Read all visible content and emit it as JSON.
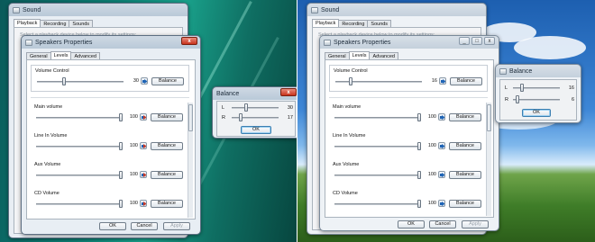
{
  "colors": {
    "vista_bg": "#0d7f74",
    "xp_sky": "#3d86d6",
    "xp_grass": "#3f7d28",
    "close_red": "#c8321c",
    "speaker_blue": "#1f64b5"
  },
  "close_glyph": "x",
  "min_glyph": "_",
  "max_glyph": "□",
  "left": {
    "sound": {
      "title": "Sound",
      "tabs": [
        "Playback",
        "Recording",
        "Sounds"
      ],
      "desc": "Select a playback device below to modify its settings:"
    },
    "props": {
      "title": "Speakers Properties",
      "tabs": [
        "General",
        "Levels",
        "Advanced"
      ],
      "volume_control": {
        "label": "Volume Control",
        "value": "30",
        "level": 0.3,
        "balance": "Balance"
      },
      "channels": [
        {
          "label": "Main volume",
          "value": "100",
          "level": 1.0,
          "balance": "Balance",
          "muted": true
        },
        {
          "label": "Line In Volume",
          "value": "100",
          "level": 1.0,
          "balance": "Balance",
          "muted": true
        },
        {
          "label": "Aux Volume",
          "value": "100",
          "level": 1.0,
          "balance": "Balance",
          "muted": true
        },
        {
          "label": "CD Volume",
          "value": "100",
          "level": 1.0,
          "balance": "Balance",
          "muted": true
        }
      ],
      "ok": "OK",
      "cancel": "Cancel",
      "apply": "Apply"
    },
    "balance": {
      "title": "Balance",
      "rows": [
        {
          "label": "L",
          "value": "30",
          "level": 0.3
        },
        {
          "label": "R",
          "value": "17",
          "level": 0.17
        }
      ],
      "ok": "OK"
    }
  },
  "right": {
    "sound": {
      "title": "Sound",
      "tabs": [
        "Playback",
        "Recording",
        "Sounds"
      ],
      "desc": "Select a playback device below to modify its settings:"
    },
    "props": {
      "title": "Speakers Properties",
      "tabs": [
        "General",
        "Levels",
        "Advanced"
      ],
      "volume_control": {
        "label": "Volume Control",
        "value": "16",
        "level": 0.16,
        "balance": "Balance"
      },
      "channels": [
        {
          "label": "Main volume",
          "value": "100",
          "level": 1.0,
          "balance": "Balance",
          "muted": false
        },
        {
          "label": "Line In Volume",
          "value": "100",
          "level": 1.0,
          "balance": "Balance",
          "muted": false
        },
        {
          "label": "Aux Volume",
          "value": "100",
          "level": 1.0,
          "balance": "Balance",
          "muted": false
        },
        {
          "label": "CD Volume",
          "value": "100",
          "level": 1.0,
          "balance": "Balance",
          "muted": false
        }
      ],
      "ok": "OK",
      "cancel": "Cancel",
      "apply": "Apply"
    },
    "balance": {
      "title": "Balance",
      "rows": [
        {
          "label": "L",
          "value": "16",
          "level": 0.16
        },
        {
          "label": "R",
          "value": "6",
          "level": 0.06
        }
      ],
      "ok": "OK"
    }
  }
}
